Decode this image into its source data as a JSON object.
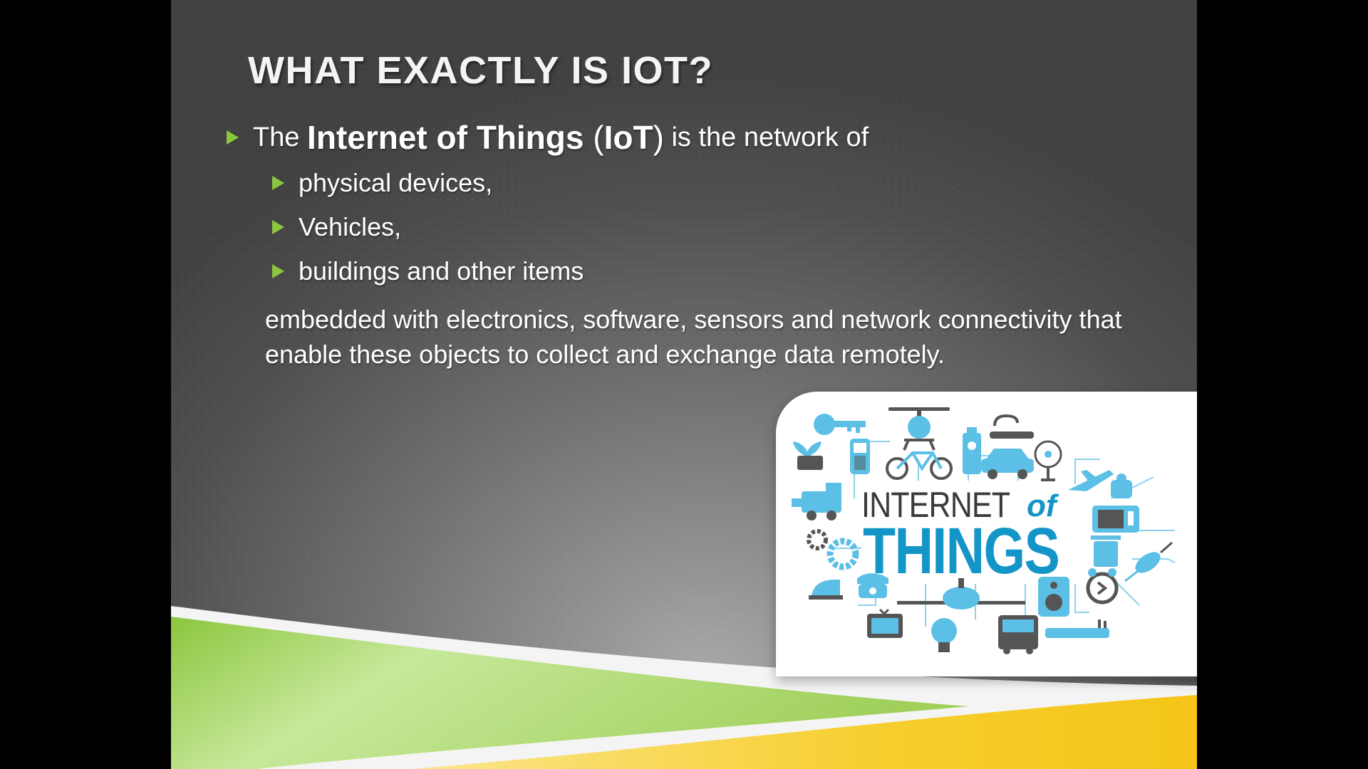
{
  "slide": {
    "title": "WHAT EXACTLY IS IOT?",
    "intro": {
      "prefix": "The ",
      "term": "Internet of Things",
      "open_paren": " (",
      "abbr": "IoT",
      "close_paren": ")",
      "suffix": " is the network of"
    },
    "sub_bullets": [
      "physical devices,",
      "Vehicles,",
      "buildings and other items"
    ],
    "paragraph": "embedded with electronics, software, sensors and network connectivity that enable these objects to collect and exchange data remotely."
  },
  "image": {
    "word_internet": "INTERNET",
    "word_of": "of",
    "word_things": "THINGS"
  },
  "colors": {
    "bullet_accent": "#8cc63f",
    "logo_blue": "#1495c8",
    "icon_blue": "#5bbfe6",
    "green_band": "#8cc63f",
    "yellow_band": "#f5c518"
  },
  "icons": [
    "key-icon",
    "drone-icon",
    "bicycle-icon",
    "phone-icon",
    "car-icon",
    "plane-icon",
    "train-icon",
    "gear-icon",
    "telephone-icon",
    "tv-icon",
    "bulb-icon",
    "bus-icon",
    "speaker-icon",
    "clock-icon",
    "trash-icon",
    "microwave-icon",
    "fan-icon",
    "plant-icon",
    "bath-icon",
    "mouse-icon",
    "router-icon",
    "iron-icon"
  ]
}
